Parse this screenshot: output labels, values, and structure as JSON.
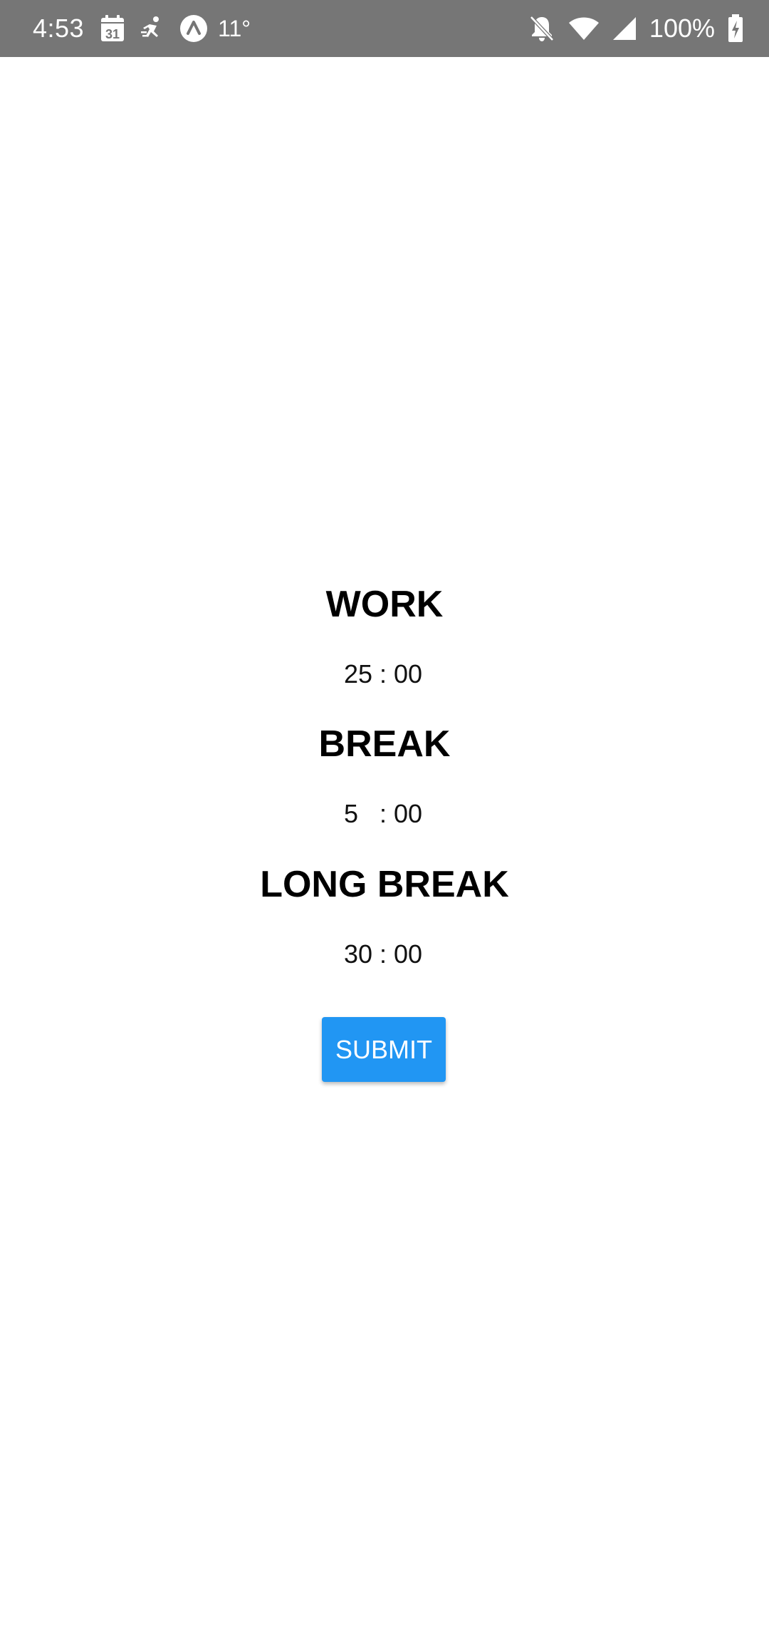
{
  "status_bar": {
    "time": "4:53",
    "temperature": "11°",
    "battery": "100%",
    "icons": [
      "calendar-icon",
      "fitness-icon",
      "arc-icon",
      "notifications-off-icon",
      "wifi-icon",
      "signal-icon",
      "battery-charging-icon"
    ],
    "calendar_day": "31"
  },
  "timers": {
    "work": {
      "label": "WORK",
      "minutes": "25",
      "separator": ":",
      "seconds": "00"
    },
    "break": {
      "label": "BREAK",
      "minutes": "5",
      "separator": ":",
      "seconds": "00"
    },
    "long_break": {
      "label": "LONG BREAK",
      "minutes": "30",
      "separator": ":",
      "seconds": "00"
    }
  },
  "submit_label": "SUBMIT",
  "colors": {
    "status_bar_bg": "#767676",
    "button_bg": "#2196f3",
    "button_text": "#ffffff",
    "heading_text": "#000000"
  }
}
